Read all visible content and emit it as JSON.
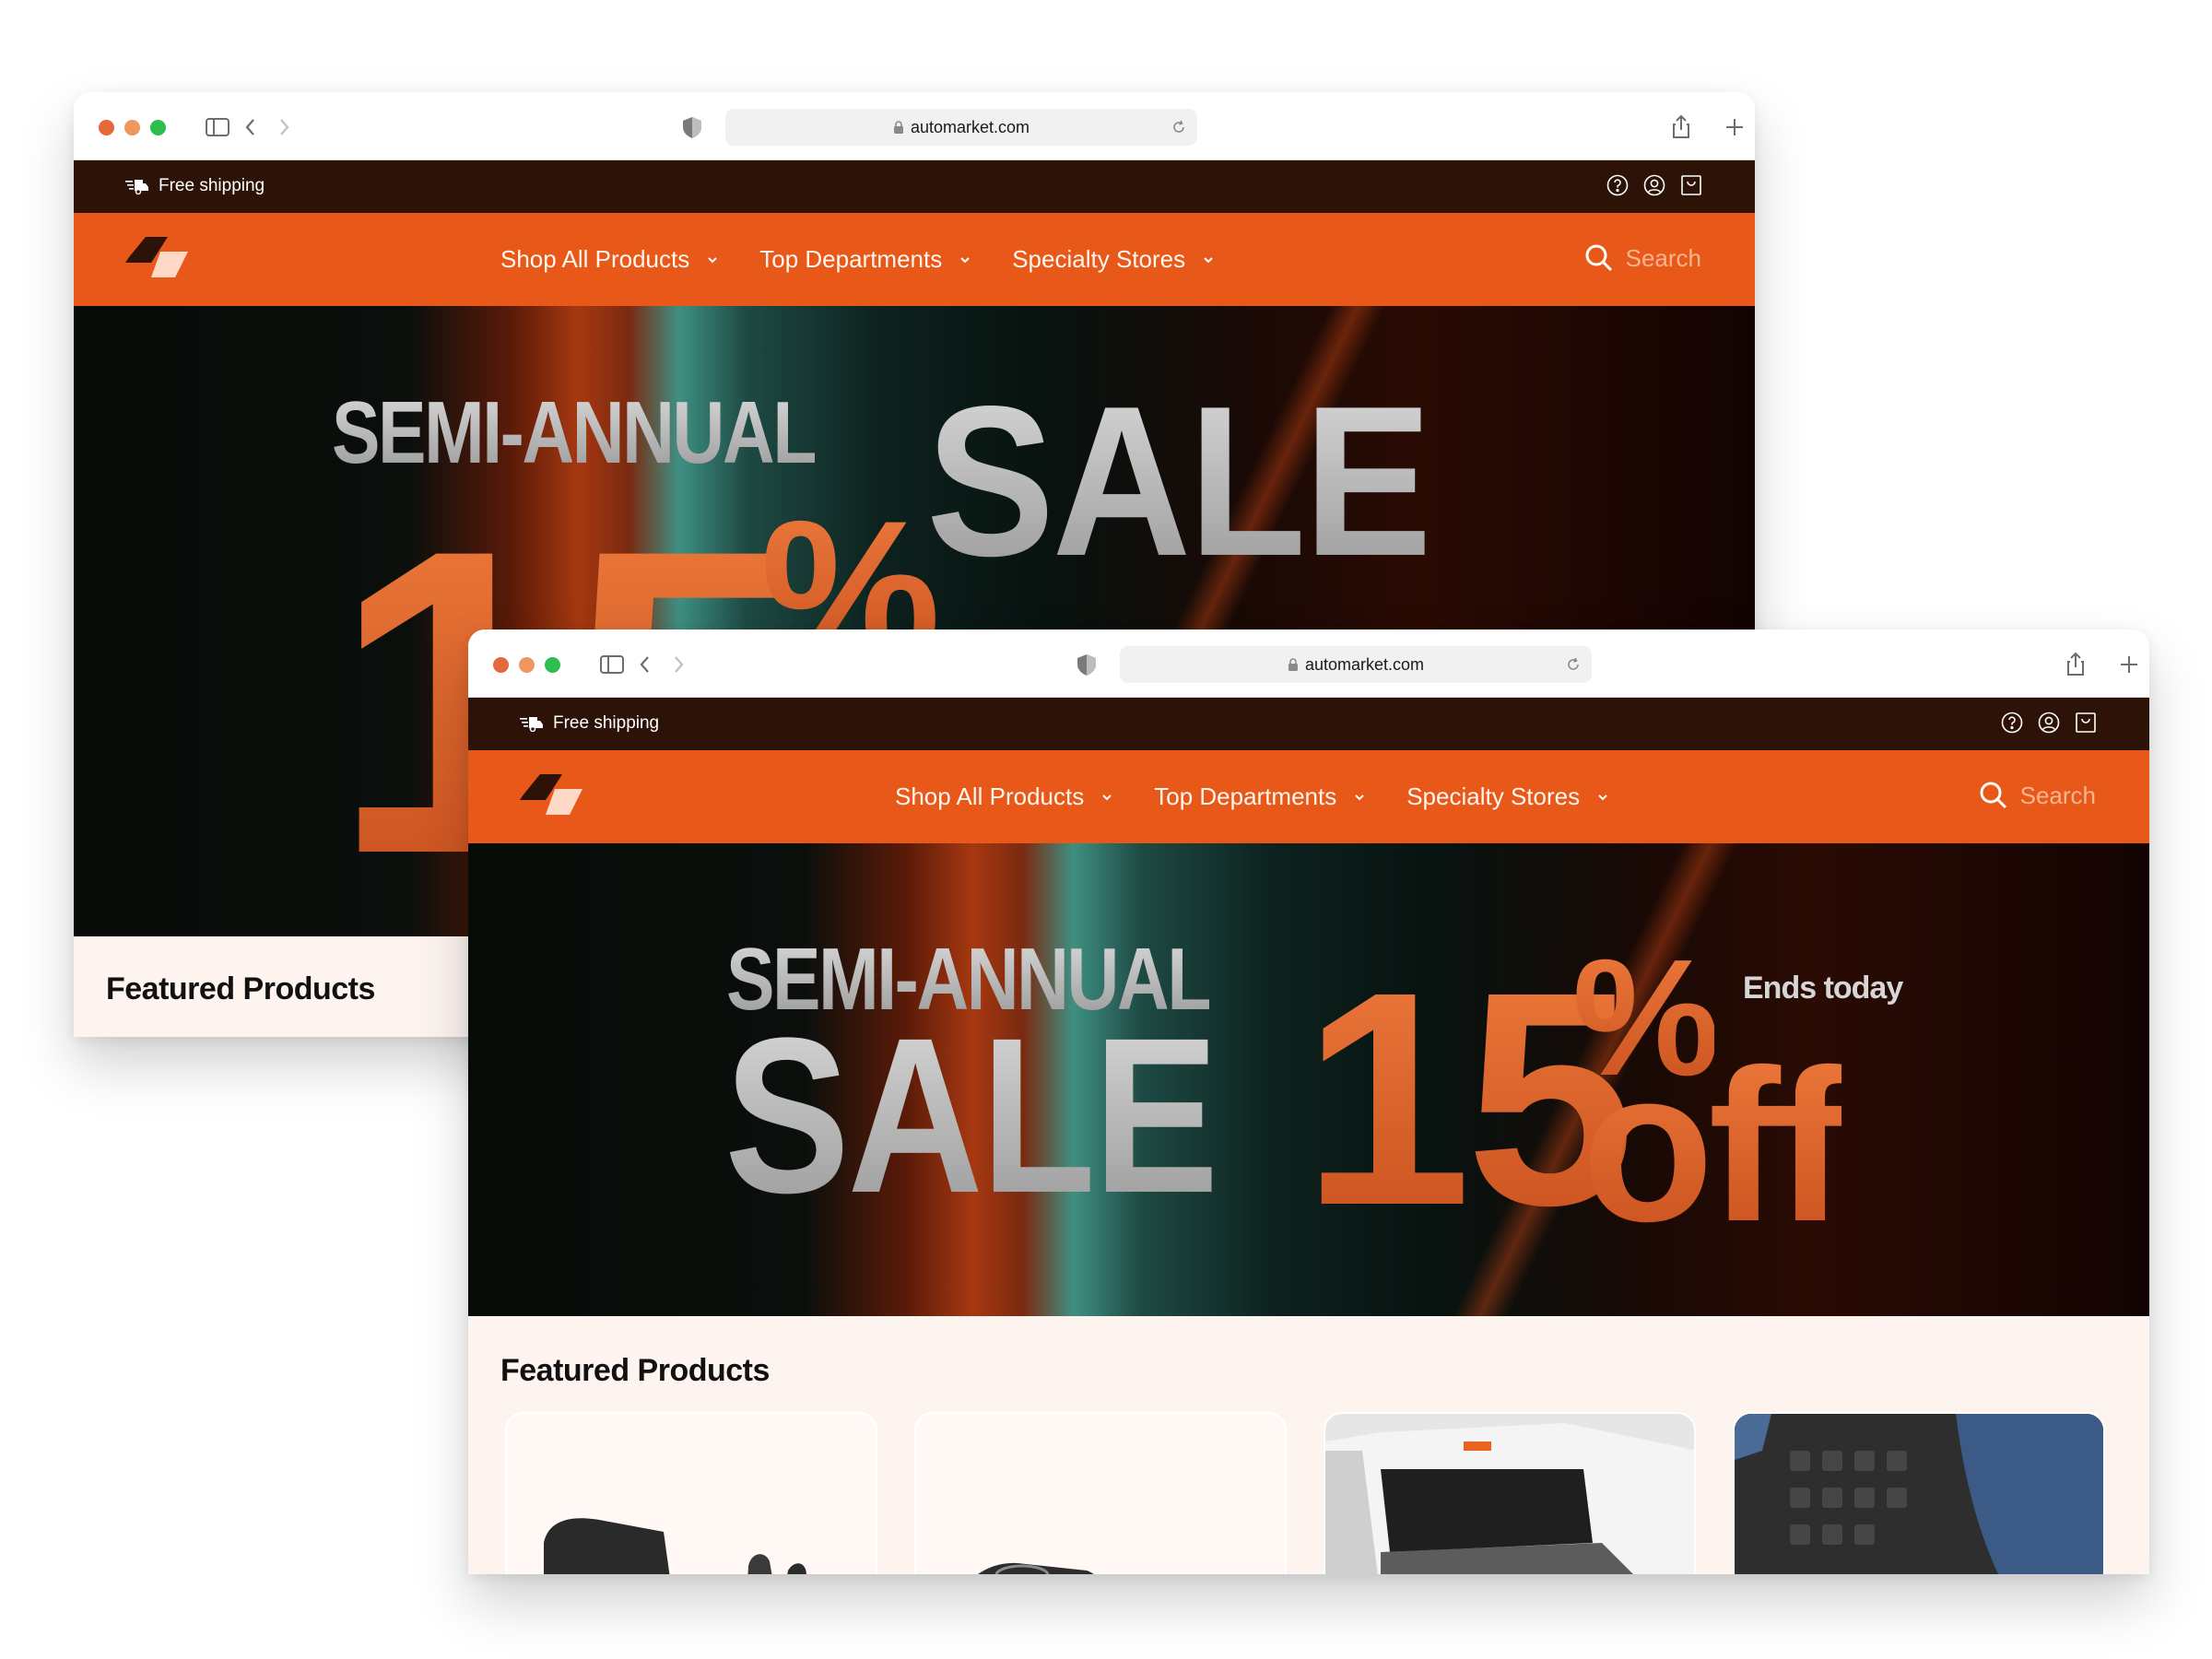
{
  "browser": {
    "url": "automarket.com",
    "traffic_lights": [
      "#e5693a",
      "#f0965e",
      "#2ebd4f"
    ]
  },
  "site": {
    "promo": {
      "text": "Free shipping",
      "icons": [
        "help-icon",
        "account-icon",
        "bag-icon"
      ]
    },
    "nav": {
      "items": [
        {
          "label": "Shop All Products"
        },
        {
          "label": "Top Departments"
        },
        {
          "label": "Specialty Stores"
        }
      ],
      "search_label": "Search"
    },
    "hero": {
      "line1": "SEMI-ANNUAL",
      "line2": "SALE",
      "discount": "15",
      "percent": "%",
      "off": "off",
      "tag": "Ends today"
    },
    "featured": {
      "title": "Featured Products",
      "products": [
        {
          "image": "mirror-product"
        },
        {
          "image": "air-intake-product"
        },
        {
          "image": "tonneau-cover-product"
        },
        {
          "image": "floor-mat-product"
        }
      ]
    },
    "colors": {
      "brand_orange": "#e85818",
      "promo_dark": "#2d1207",
      "featured_bg": "#fdf4f0"
    }
  }
}
